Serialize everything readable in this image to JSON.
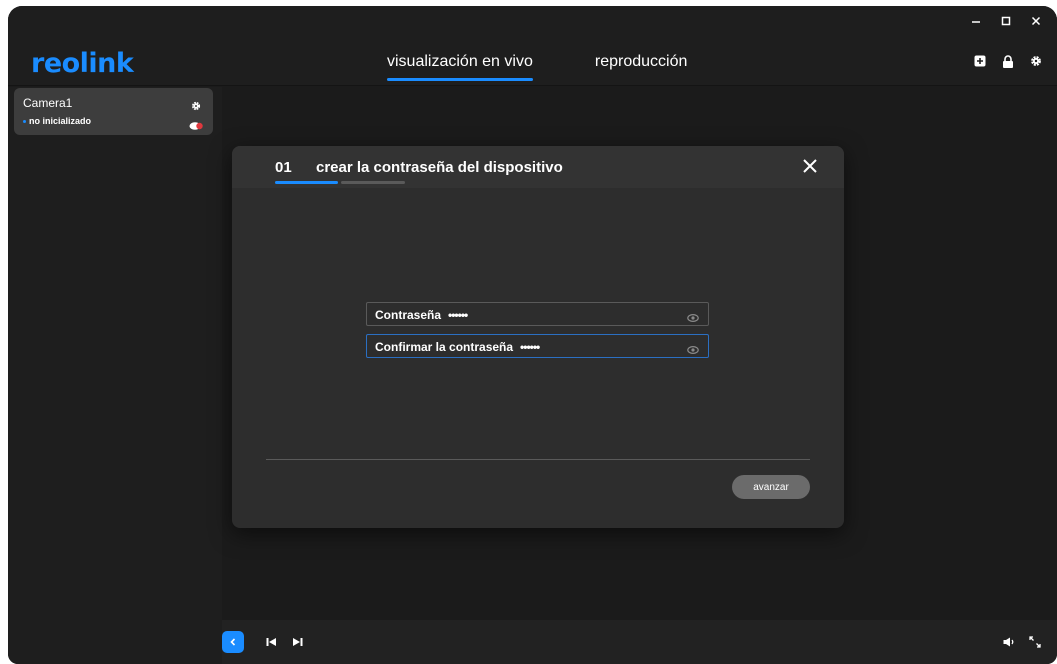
{
  "header": {
    "logo": "reolink",
    "tabs": [
      {
        "label": "visualización en vivo",
        "active": true
      },
      {
        "label": "reproducción",
        "active": false
      }
    ]
  },
  "sidebar": {
    "devices": [
      {
        "name": "Camera1",
        "status": "no inicializado"
      }
    ]
  },
  "dialog": {
    "step_number": "01",
    "title": "crear la contraseña del dispositivo",
    "fields": [
      {
        "label": "Contraseña",
        "value": "••••••"
      },
      {
        "label": "Confirmar la contraseña",
        "value": "••••••"
      }
    ],
    "next_label": "avanzar"
  },
  "colors": {
    "accent": "#1a8cff",
    "background": "#1b1b1b",
    "dialog": "#2d2d2d"
  }
}
